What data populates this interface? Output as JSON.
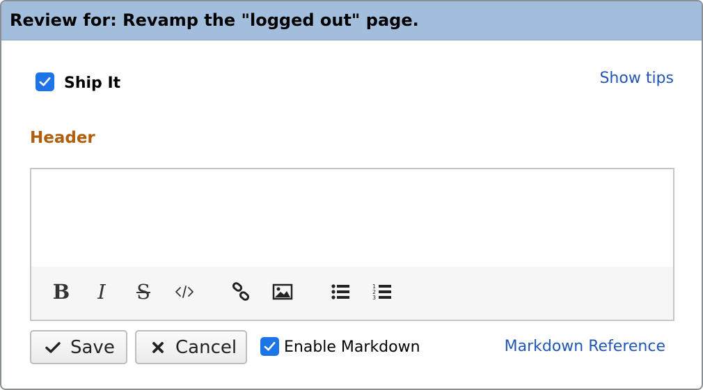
{
  "dialog": {
    "title": "Review for: Revamp the \"logged out\" page."
  },
  "ship_it": {
    "label": "Ship It",
    "checked": true
  },
  "show_tips_link": "Show tips",
  "header_section": {
    "label": "Header",
    "text_value": ""
  },
  "toolbar": {
    "buttons": [
      "bold-icon",
      "italic-icon",
      "strikethrough-icon",
      "code-icon",
      "link-icon",
      "image-icon",
      "bulleted-list-icon",
      "numbered-list-icon"
    ],
    "bold_glyph": "B",
    "italic_glyph": "I",
    "strike_glyph": "S"
  },
  "actions": {
    "save_label": "Save",
    "cancel_label": "Cancel"
  },
  "markdown": {
    "enable_label": "Enable Markdown",
    "enabled": true,
    "reference_link": "Markdown Reference"
  },
  "colors": {
    "titlebar": "#a3bedc",
    "accent_checkbox": "#1c74e6",
    "section_label": "#b05e0c",
    "link": "#1f56b6"
  }
}
